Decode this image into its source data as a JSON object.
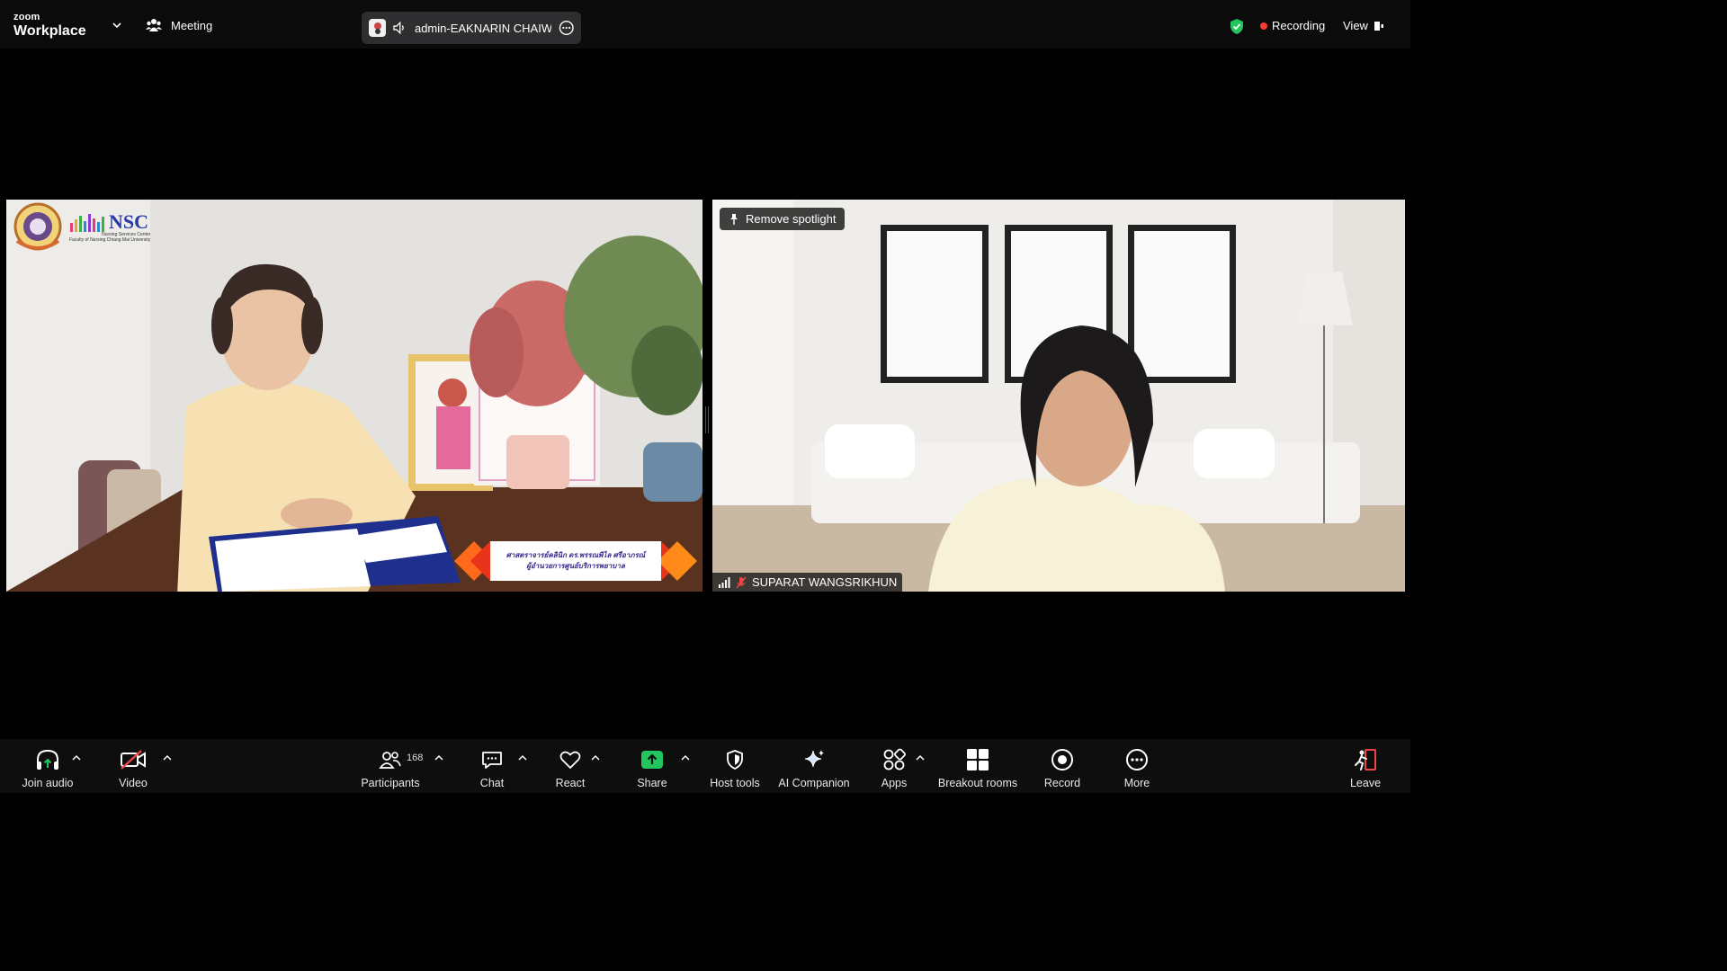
{
  "app": {
    "brand_top": "zoom",
    "brand_bottom": "Workplace"
  },
  "topbar": {
    "meeting_label": "Meeting",
    "active_speaker": "admin-EAKNARIN CHAIWOC",
    "recording_label": "Recording",
    "view_label": "View"
  },
  "tiles": {
    "left": {
      "logo_text": "NSC",
      "logo_sub1": "Nursing Services Center",
      "logo_sub2": "Faculty of Nursing Chiang Mai University",
      "caption_line1": "ศาสตราจารย์คลินิก ดร.พรรณพิไล ศรีอาภรณ์",
      "caption_line2": "ผู้อำนวยการศูนย์บริการพยาบาล"
    },
    "right": {
      "spotlight_label": "Remove spotlight",
      "participant_name": "SUPARAT WANGSRIKHUN"
    }
  },
  "toolbar": {
    "join_audio": "Join audio",
    "video": "Video",
    "participants": "Participants",
    "participants_count": "168",
    "chat": "Chat",
    "react": "React",
    "share": "Share",
    "host_tools": "Host tools",
    "ai_companion": "AI Companion",
    "apps": "Apps",
    "breakout_rooms": "Breakout rooms",
    "record": "Record",
    "more": "More",
    "leave": "Leave"
  },
  "colors": {
    "background": "#000000",
    "toolbar": "#0e0e0e",
    "share_green": "#22c55e",
    "leave_red": "#ef4444",
    "recording_red": "#ff3b30",
    "shield_green": "#22c55e",
    "video_off_red": "#ef4444"
  },
  "icons": [
    "chevron-down-icon",
    "participants-group-icon",
    "speaker-icon",
    "more-circle-icon",
    "shield-check-icon",
    "view-icon",
    "pin-icon",
    "signal-icon",
    "mic-muted-icon",
    "headphones-icon",
    "video-off-icon",
    "participants-icon",
    "chat-icon",
    "heart-icon",
    "share-arrow-icon",
    "host-shield-icon",
    "sparkle-icon",
    "apps-icon",
    "breakout-grid-icon",
    "record-icon",
    "more-dots-icon",
    "leave-icon"
  ]
}
